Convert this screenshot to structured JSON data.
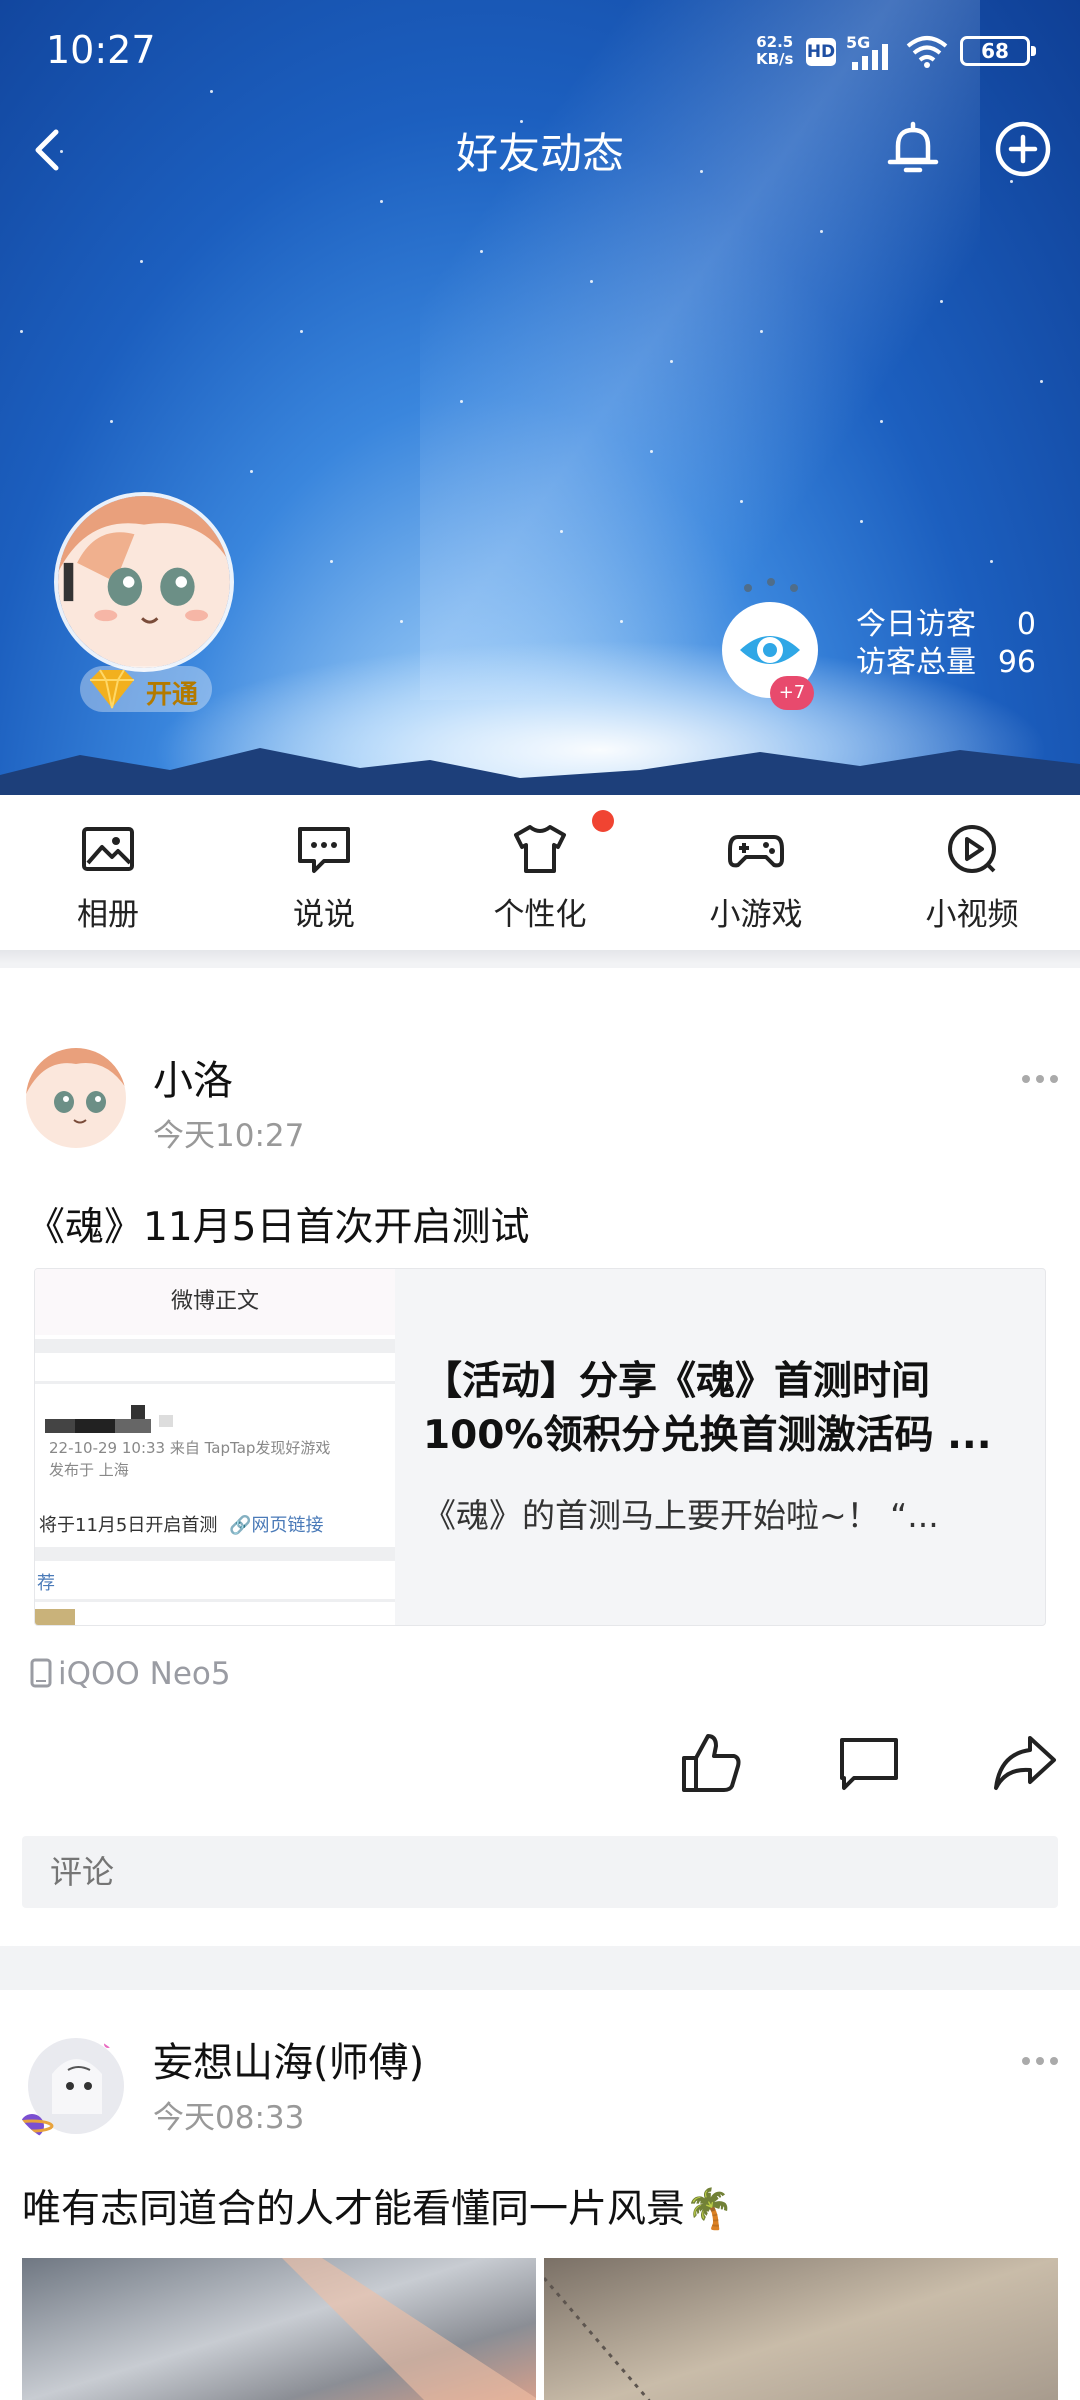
{
  "status_bar": {
    "time": "10:27",
    "speed_value": "62.5",
    "speed_unit": "KB/s",
    "hd": "HD",
    "network": "5G",
    "battery": "68"
  },
  "nav": {
    "title": "好友动态",
    "icons": [
      "back-icon",
      "bell-icon",
      "plus-circle-icon"
    ]
  },
  "profile": {
    "vip_label": "开通",
    "visitor_badge": "+7",
    "today_visitors_label": "今日访客",
    "today_visitors_value": "0",
    "total_visitors_label": "访客总量",
    "total_visitors_value": "96"
  },
  "menu": {
    "items": [
      {
        "label": "相册",
        "icon": "photo-album-icon"
      },
      {
        "label": "说说",
        "icon": "chat-bubble-icon"
      },
      {
        "label": "个性化",
        "icon": "tshirt-icon"
      },
      {
        "label": "小游戏",
        "icon": "gamepad-icon"
      },
      {
        "label": "小视频",
        "icon": "video-play-icon"
      }
    ],
    "notification_dot_color": "#f04432"
  },
  "posts": [
    {
      "author": "小洛",
      "time": "今天10:27",
      "text": "《魂》11月5日首次开启测试",
      "link_card": {
        "thumb_header": "微博正文",
        "thumb_meta_line1": "22-10-29 10:33  来自 TapTap发现好游戏",
        "thumb_meta_line2": "发布于 上海",
        "thumb_link_prefix": "将于11月5日开启首测",
        "thumb_link_text": "网页链接",
        "thumb_more": "荐",
        "title_line1": "【活动】分享《魂》首测时间",
        "title_line2": "100%领积分兑换首测激活码 ...",
        "desc": "《魂》的首测马上要开始啦~！  “..."
      },
      "device": "iQOO Neo5",
      "comment_placeholder": "评论"
    },
    {
      "author": "妄想山海(师傅)",
      "time": "今天08:33",
      "text": "唯有志同道合的人才能看懂同一片风景🌴"
    }
  ],
  "colors": {
    "sky_dark": "#0f3f95",
    "sky_light": "#8fc3f4",
    "accent_red": "#e84a6d",
    "vip_gold": "#f2b01e"
  }
}
